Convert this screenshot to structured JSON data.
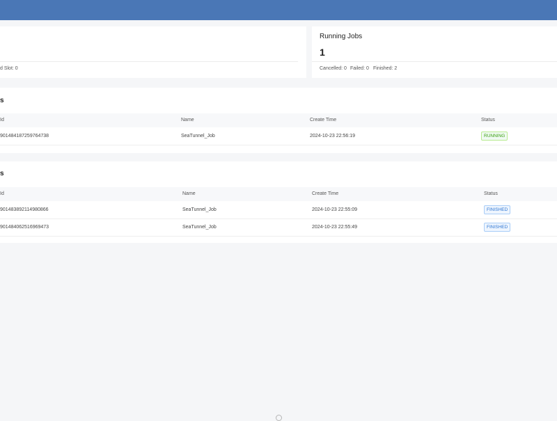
{
  "summary": {
    "left_card": {
      "slot_text": "d Slot: 0"
    },
    "running_jobs": {
      "title": "Running Jobs",
      "count": "1",
      "stats": {
        "cancelled": "Cancelled: 0",
        "failed": "Failed: 0",
        "finished": "Finished: 2"
      }
    }
  },
  "running_table": {
    "heading": "s",
    "columns": {
      "id": "Id",
      "name": "Name",
      "create_time": "Create Time",
      "status": "Status"
    },
    "rows": [
      {
        "id": "901484187259764738",
        "name": "SeaTunnel_Job",
        "create_time": "2024-10-23 22:56:19",
        "status": "RUNNING"
      }
    ]
  },
  "finished_table": {
    "heading": "s",
    "columns": {
      "id": "Id",
      "name": "Name",
      "create_time": "Create Time",
      "status": "Status"
    },
    "rows": [
      {
        "id": "901483892114980866",
        "name": "SeaTunnel_Job",
        "create_time": "2024-10-23 22:55:09",
        "status": "FINISHED"
      },
      {
        "id": "901484062516969473",
        "name": "SeaTunnel_Job",
        "create_time": "2024-10-23 22:55:49",
        "status": "FINISHED"
      }
    ]
  },
  "colors": {
    "header": "#4a77b6",
    "running": "#389e0d",
    "finished": "#2f77d4"
  }
}
